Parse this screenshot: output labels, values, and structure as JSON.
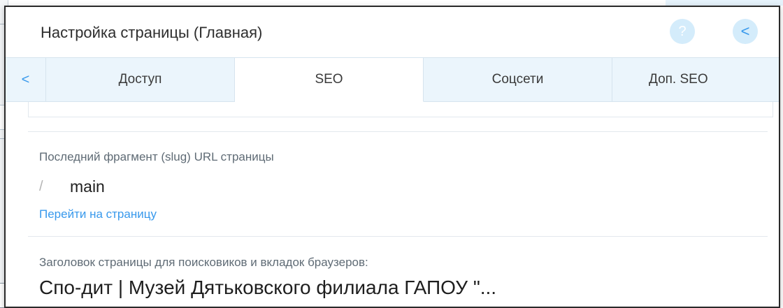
{
  "header": {
    "title": "Настройка страницы (Главная)",
    "help_icon": "?",
    "back_icon": "<"
  },
  "tabs": {
    "prev_arrow": "<",
    "items": [
      {
        "label": "Доступ",
        "active": false
      },
      {
        "label": "SEO",
        "active": true
      },
      {
        "label": "Соцсети",
        "active": false
      },
      {
        "label": "Доп. SEO",
        "active": false
      }
    ]
  },
  "slug": {
    "label": "Последний фрагмент (slug) URL страницы",
    "prefix": "/",
    "value": "main"
  },
  "goto_link": "Перейти на страницу",
  "seo_title": {
    "label": "Заголовок страницы для поисковиков и вкладок браузеров:",
    "value": "Спо-дит | Музей Дятьковского филиала ГАПОУ \"..."
  },
  "colors": {
    "accent": "#3899ec",
    "tab_bar": "#ebf5fc",
    "header_buttons": "#d4ecfb",
    "label_text": "#5f6b75"
  }
}
